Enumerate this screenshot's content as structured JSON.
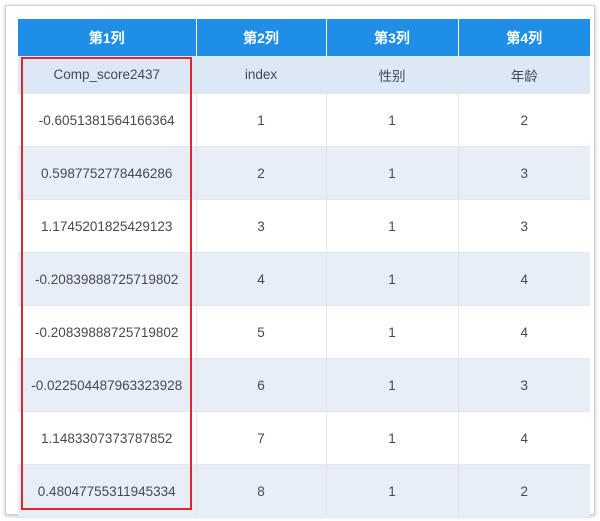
{
  "table": {
    "headers": [
      "第1列",
      "第2列",
      "第3列",
      "第4列"
    ],
    "subheaders": [
      "Comp_score2437",
      "index",
      "性别",
      "年龄"
    ],
    "rows": [
      [
        "-0.6051381564166364",
        "1",
        "1",
        "2"
      ],
      [
        "0.5987752778446286",
        "2",
        "1",
        "3"
      ],
      [
        "1.1745201825429123",
        "3",
        "1",
        "3"
      ],
      [
        "-0.20839888725719802",
        "4",
        "1",
        "4"
      ],
      [
        "-0.20839888725719802",
        "5",
        "1",
        "4"
      ],
      [
        "-0.022504487963323928",
        "6",
        "1",
        "3"
      ],
      [
        "1.1483307373787852",
        "7",
        "1",
        "4"
      ],
      [
        "0.48047755311945334",
        "8",
        "1",
        "2"
      ]
    ]
  },
  "colors": {
    "header_bg": "#1e8ee7",
    "subheader_bg": "#dde8f7",
    "alt_row_bg": "#e8eef8",
    "highlight_border": "#e0262d"
  }
}
